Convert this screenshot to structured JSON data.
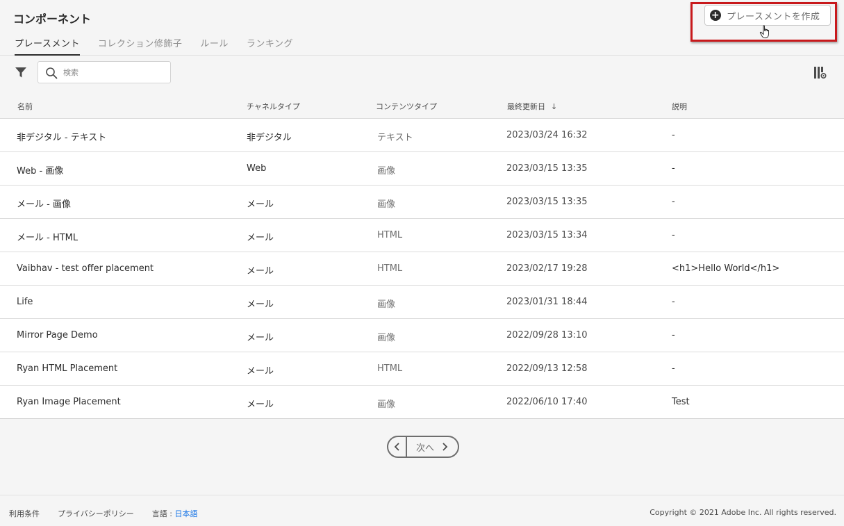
{
  "header": {
    "title": "コンポーネント",
    "create_button_label": "プレースメントを作成"
  },
  "tabs": [
    {
      "label": "プレースメント",
      "active": true
    },
    {
      "label": "コレクション修飾子",
      "active": false
    },
    {
      "label": "ルール",
      "active": false
    },
    {
      "label": "ランキング",
      "active": false
    }
  ],
  "toolbar": {
    "search_placeholder": "検索"
  },
  "table": {
    "columns": [
      "名前",
      "チャネルタイプ",
      "コンテンツタイプ",
      "最終更新日",
      "説明"
    ],
    "sort_icon": "arrow-down-icon",
    "rows": [
      {
        "name": "非デジタル - テキスト",
        "channel": "非デジタル",
        "content": "テキスト",
        "updated": "2023/03/24 16:32",
        "description": "-"
      },
      {
        "name": "Web - 画像",
        "channel": "Web",
        "content": "画像",
        "updated": "2023/03/15 13:35",
        "description": "-"
      },
      {
        "name": "メール - 画像",
        "channel": "メール",
        "content": "画像",
        "updated": "2023/03/15 13:35",
        "description": "-"
      },
      {
        "name": "メール - HTML",
        "channel": "メール",
        "content": "HTML",
        "updated": "2023/03/15 13:34",
        "description": "-"
      },
      {
        "name": "Vaibhav - test offer placement",
        "channel": "メール",
        "content": "HTML",
        "updated": "2023/02/17 19:28",
        "description": "<h1>Hello World</h1>"
      },
      {
        "name": "Life",
        "channel": "メール",
        "content": "画像",
        "updated": "2023/01/31 18:44",
        "description": "-"
      },
      {
        "name": "Mirror Page Demo",
        "channel": "メール",
        "content": "画像",
        "updated": "2022/09/28 13:10",
        "description": "-"
      },
      {
        "name": "Ryan HTML Placement",
        "channel": "メール",
        "content": "HTML",
        "updated": "2022/09/13 12:58",
        "description": "-"
      },
      {
        "name": "Ryan Image Placement",
        "channel": "メール",
        "content": "画像",
        "updated": "2022/06/10 17:40",
        "description": "Test"
      }
    ]
  },
  "pagination": {
    "next_label": "次へ"
  },
  "footer": {
    "terms": "利用条件",
    "privacy": "プライバシーポリシー",
    "language_label": "言語 : ",
    "language_value": "日本語",
    "copyright": "Copyright © 2021 Adobe Inc. All rights reserved."
  },
  "colors": {
    "highlight": "#c8191c",
    "link": "#1473e6",
    "background": "#f5f5f5"
  }
}
